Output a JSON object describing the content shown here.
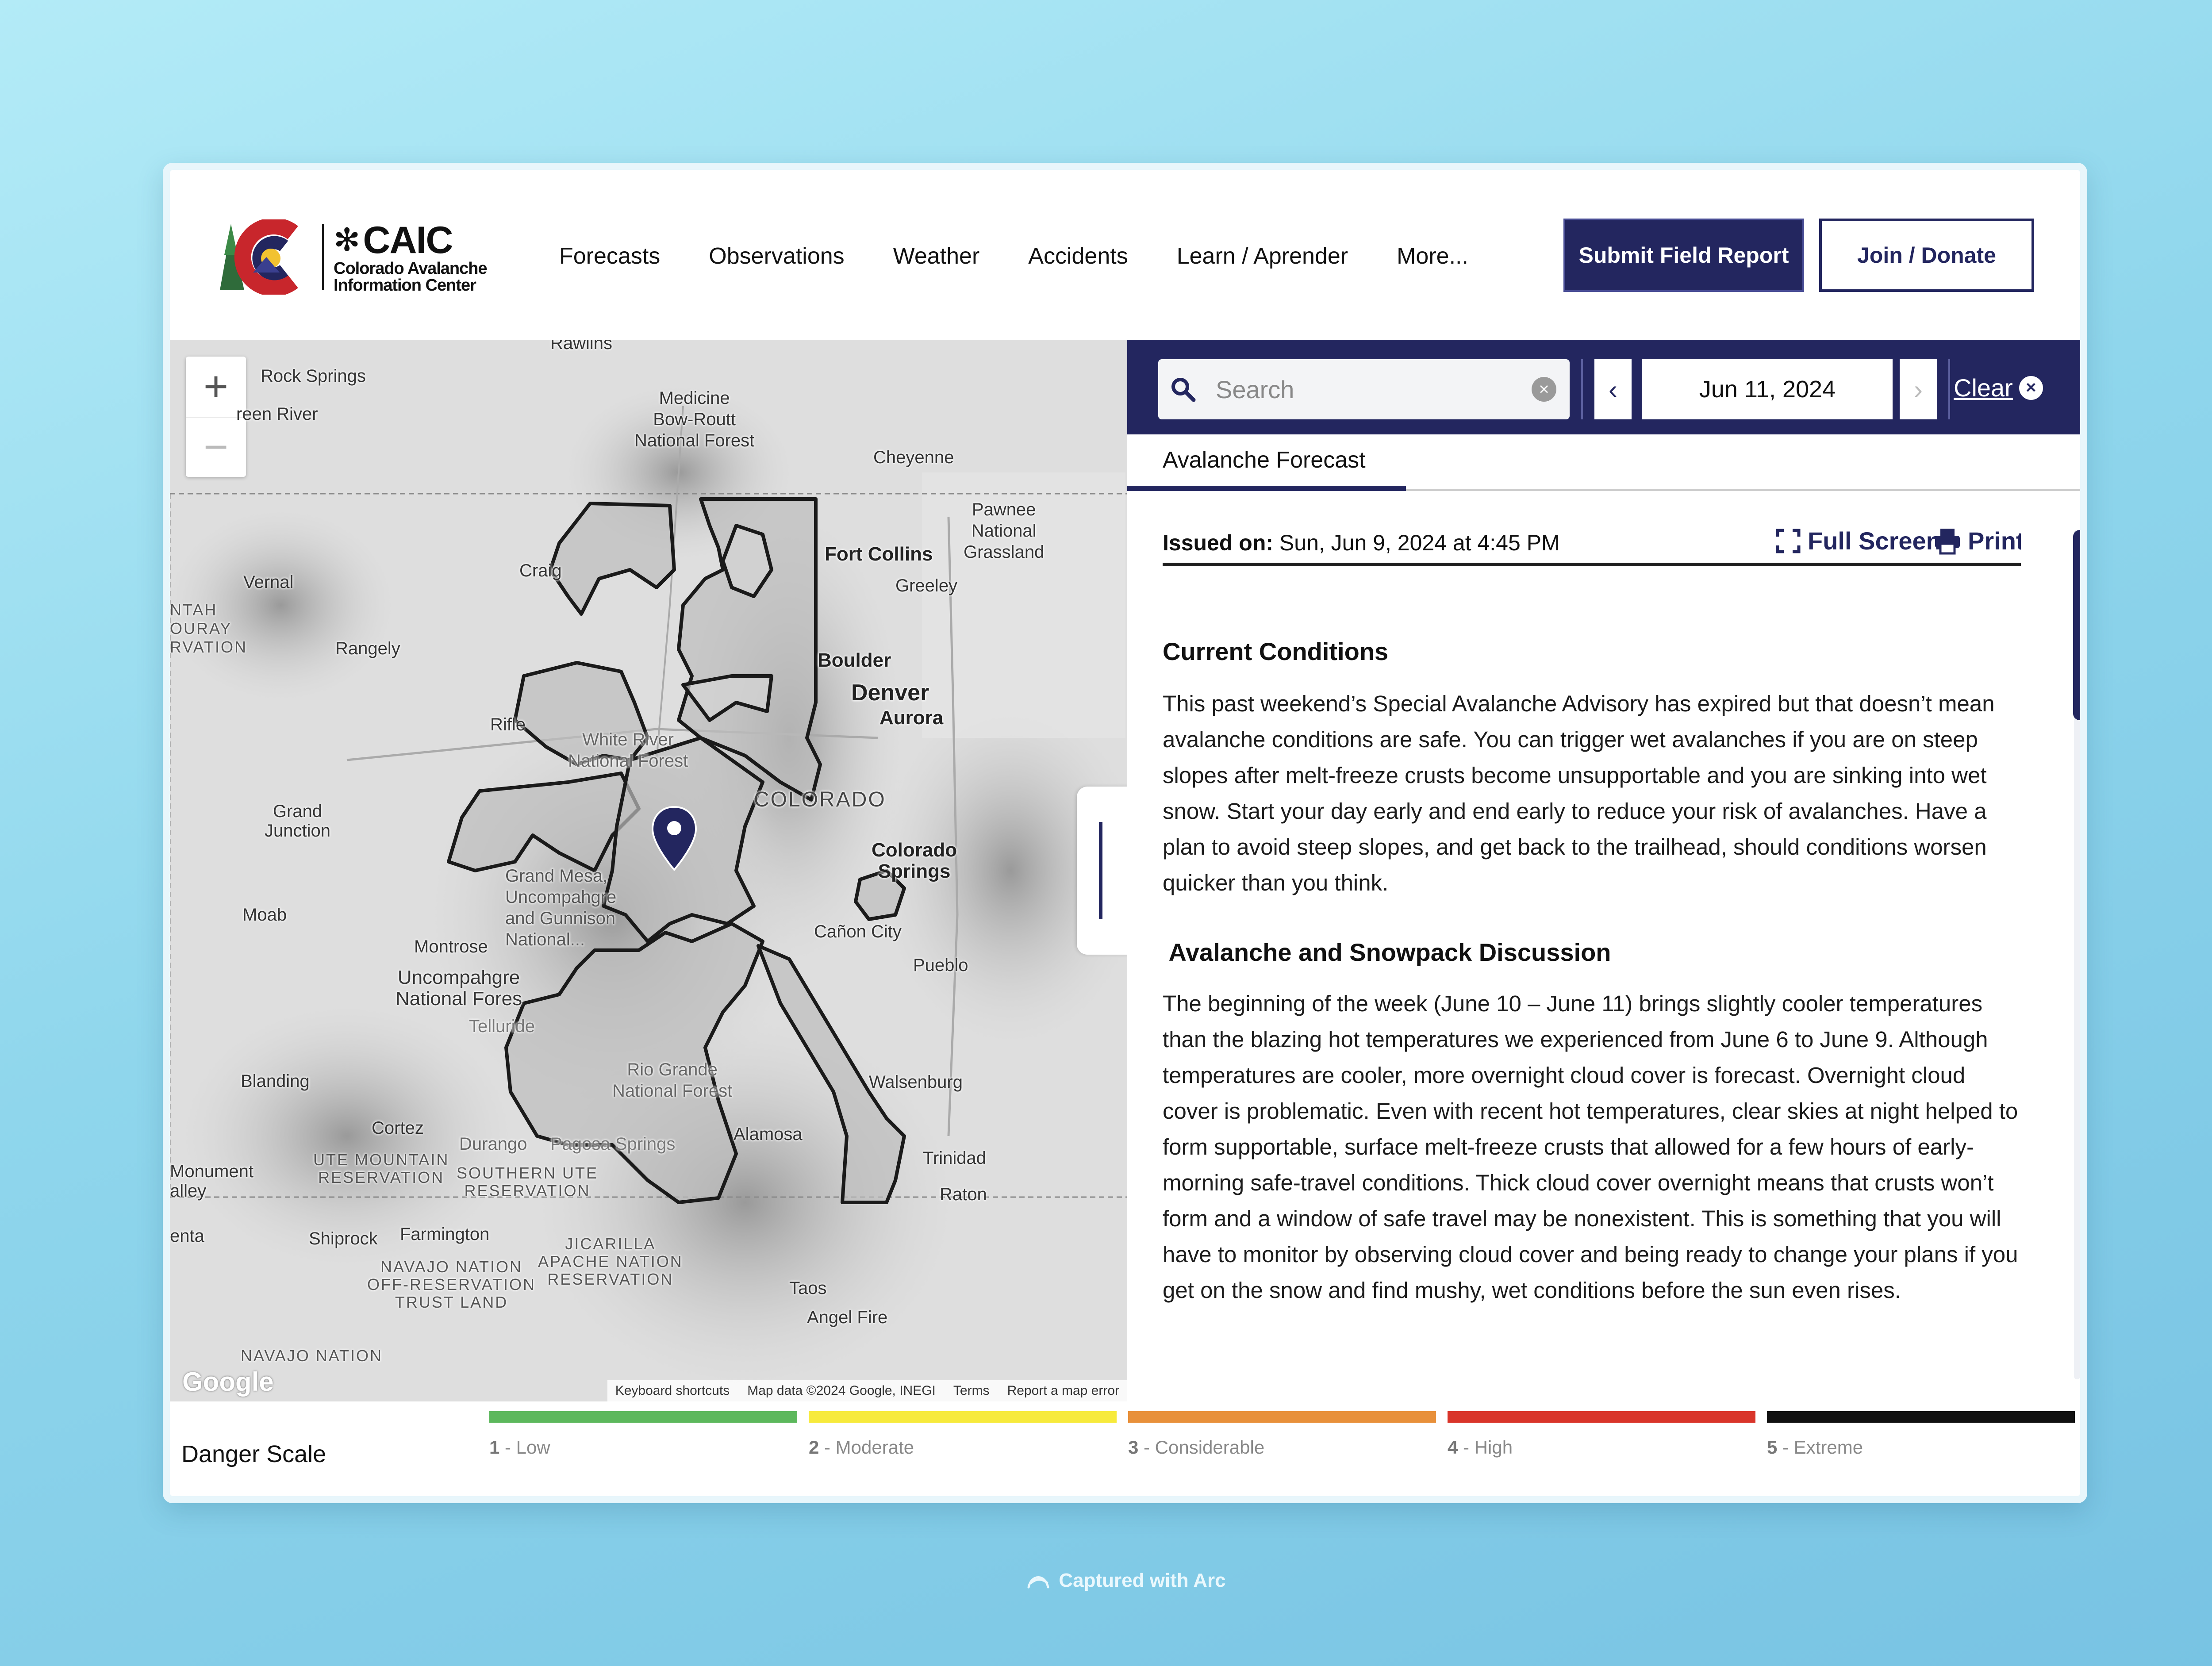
{
  "header": {
    "logo": {
      "wordmark": "CAIC",
      "subtitle_line1": "Colorado Avalanche",
      "subtitle_line2": "Information Center"
    },
    "nav": [
      "Forecasts",
      "Observations",
      "Weather",
      "Accidents",
      "Learn / Aprender",
      "More..."
    ],
    "submit_label": "Submit Field Report",
    "join_label": "Join / Donate"
  },
  "map": {
    "zoom_in": "+",
    "zoom_out": "−",
    "labels": {
      "rawlins": "Rawlins",
      "rock_springs": "Rock Springs",
      "green_river": "reen River",
      "medicine_bow": "Medicine\nBow-Routt\nNational Forest",
      "cheyenne": "Cheyenne",
      "pawnee": "Pawnee\nNational\nGrassland",
      "vernal": "Vernal",
      "craig": "Craig",
      "fort_collins": "Fort Collins",
      "greeley": "Greeley",
      "uintah": "NTAH\nOURAY\nRVATION",
      "rangely": "Rangely",
      "boulder": "Boulder",
      "denver": "Denver",
      "aurora": "Aurora",
      "rifle": "Rifle",
      "white_river": "White River\nNational Forest",
      "colorado": "COLORADO",
      "grand_junction": "Grand\nJunction",
      "colorado_springs": "Colorado\nSprings",
      "grand_mesa": "Grand Mesa,\nUncompahgre\nand Gunnison\nNational...",
      "moab": "Moab",
      "montrose": "Montrose",
      "canon_city": "Cañon City",
      "pueblo": "Pueblo",
      "uncompahgre": "Uncompahgre\nNational Fores",
      "telluride": "Telluride",
      "blanding": "Blanding",
      "rio_grande": "Rio Grande\nNational Forest",
      "walsenburg": "Walsenburg",
      "cortez": "Cortez",
      "alamosa": "Alamosa",
      "durango": "Durango",
      "pagosa": "Pagosa Springs",
      "trinidad": "Trinidad",
      "monument": "Monument\nalley",
      "ute_mountain": "UTE MOUNTAIN\nRESERVATION",
      "southern_ute": "SOUTHERN UTE\nRESERVATION",
      "raton": "Raton",
      "enta": "enta",
      "shiprock": "Shiprock",
      "farmington": "Farmington",
      "jicarilla": "JICARILLA\nAPACHE NATION\nRESERVATION",
      "navajo_offres": "NAVAJO NATION\nOFF-RESERVATION\nTRUST LAND",
      "taos": "Taos",
      "angel_fire": "Angel Fire",
      "navajo_nation": "NAVAJO NATION"
    },
    "google": "Google",
    "footer": [
      "Keyboard shortcuts",
      "Map data ©2024 Google, INEGI",
      "Terms",
      "Report a map error"
    ]
  },
  "panel": {
    "search_placeholder": "Search",
    "date": "Jun 11, 2024",
    "clear_label": "Clear",
    "tab_label": "Avalanche Forecast",
    "issued_label": "Issued on:",
    "issued_value": " Sun, Jun 9, 2024 at 4:45 PM",
    "fullscreen_label": "Full Screen",
    "print_label": "Print",
    "section1_title": "Current Conditions",
    "section1_body": "This past weekend’s Special Avalanche Advisory has expired but that doesn’t mean avalanche conditions are safe. You can trigger wet avalanches if you are on steep slopes after melt-freeze crusts become unsupportable and you are sinking into wet snow. Start your day early and end early to reduce your risk of avalanches. Have a plan to avoid steep slopes, and get back to the trailhead, should conditions worsen quicker than you think.",
    "section2_title": " Avalanche and Snowpack Discussion",
    "section2_body": "The beginning of the week (June 10 – June 11) brings slightly cooler temperatures than the blazing hot temperatures we experienced from June 6 to June 9. Although temperatures are cooler, more overnight cloud cover is forecast. Overnight cloud cover is problematic. Even with recent hot temperatures, clear skies at night helped to form supportable, surface melt-freeze crusts that allowed for a few hours of early-morning safe-travel conditions. Thick cloud cover overnight means that crusts won’t form and a window of safe travel may be nonexistent. This is something that you will have to monitor by observing cloud cover and being ready to change your plans if you get on the snow and find mushy, wet conditions before the sun even rises."
  },
  "danger_scale": {
    "title": "Danger Scale",
    "levels": [
      {
        "num": "1",
        "label": " - Low",
        "color": "#5cb85c"
      },
      {
        "num": "2",
        "label": " - Moderate",
        "color": "#f7ea3c"
      },
      {
        "num": "3",
        "label": " - Considerable",
        "color": "#e8903a"
      },
      {
        "num": "4",
        "label": " - High",
        "color": "#d9352a"
      },
      {
        "num": "5",
        "label": " - Extreme",
        "color": "#111111"
      }
    ]
  },
  "captured": "Captured with Arc"
}
